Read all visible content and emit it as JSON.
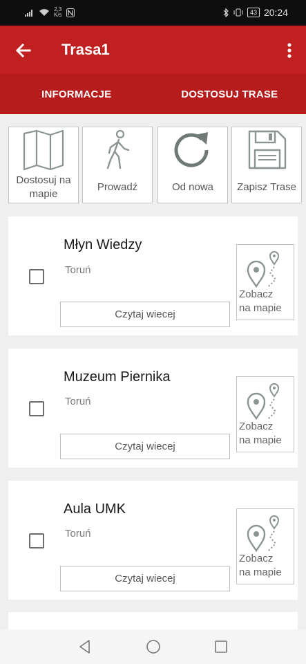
{
  "status_bar": {
    "speed_value": "2,3",
    "speed_unit": "K/s",
    "time": "20:24",
    "battery": "43"
  },
  "app_bar": {
    "title": "Trasa1",
    "back_icon": "arrow-left-icon",
    "menu_icon": "more-vert-icon"
  },
  "tabs": [
    {
      "label": "INFORMACJE"
    },
    {
      "label": "DOSTOSUJ TRASE"
    }
  ],
  "actions": [
    {
      "label": "Dostosuj na mapie",
      "line1": "Dostosuj na",
      "line2": "mapie",
      "icon": "map-icon"
    },
    {
      "label": "Prowadź",
      "icon": "walking-person-icon"
    },
    {
      "label": "Od nowa",
      "icon": "refresh-icon"
    },
    {
      "label": "Zapisz Trase",
      "icon": "save-icon"
    }
  ],
  "places": [
    {
      "name": "Młyn Wiedzy",
      "city": "Toruń",
      "read_more": "Czytaj wiecej",
      "map_line1": "Zobacz",
      "map_line2": "na mapie",
      "checked": false
    },
    {
      "name": "Muzeum Piernika",
      "city": "Toruń",
      "read_more": "Czytaj wiecej",
      "map_line1": "Zobacz",
      "map_line2": "na mapie",
      "checked": false
    },
    {
      "name": "Aula UMK",
      "city": "Toruń",
      "read_more": "Czytaj wiecej",
      "map_line1": "Zobacz",
      "map_line2": "na mapie",
      "checked": false
    }
  ],
  "colors": {
    "appbar": "#c0201f",
    "tabs": "#b71c1c",
    "icon_gray": "#8a9591"
  }
}
